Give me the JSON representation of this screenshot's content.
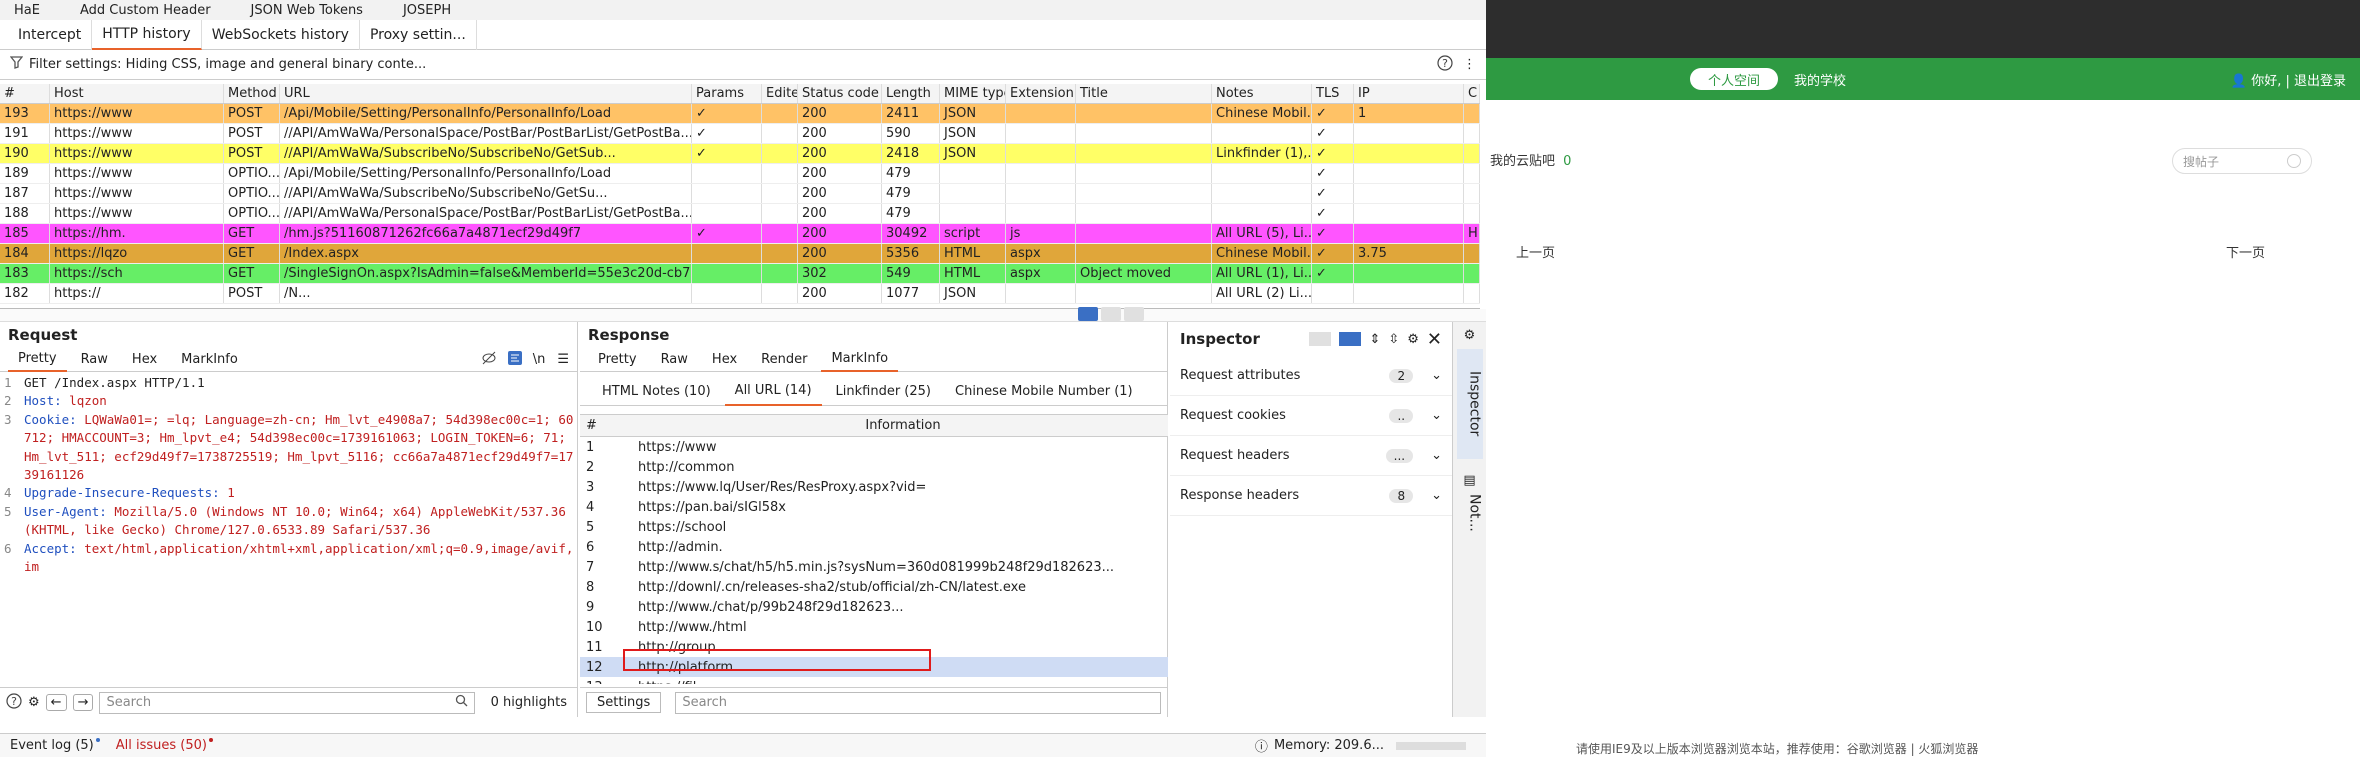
{
  "menubar": [
    "HaE",
    "Add Custom Header",
    "JSON Web Tokens",
    "JOSEPH"
  ],
  "tabs": [
    "Intercept",
    "HTTP history",
    "WebSockets history",
    "Proxy settin..."
  ],
  "filter": "Filter settings: Hiding CSS, image and general binary conte...",
  "columns": [
    "#",
    "Host",
    "Method",
    "URL",
    "Params",
    "Edited",
    "Status code",
    "Length",
    "MIME type",
    "Extension",
    "Title",
    "Notes",
    "TLS",
    "IP",
    "C"
  ],
  "rows": [
    {
      "id": "193",
      "host": "https://www",
      "method": "POST",
      "url": "/Api/Mobile/Setting/PersonalInfo/PersonalInfo/Load",
      "params": "✓",
      "status": "200",
      "length": "2411",
      "mime": "JSON",
      "ext": "",
      "title": "",
      "notes": "Chinese Mobil...",
      "tls": "✓",
      "ip": "1",
      "c": "",
      "bg": "#ffc266"
    },
    {
      "id": "191",
      "host": "https://www",
      "method": "POST",
      "url": "//API/AmWaWa/PersonalSpace/PostBar/PostBarList/GetPostBa...",
      "params": "✓",
      "status": "200",
      "length": "590",
      "mime": "JSON",
      "ext": "",
      "title": "",
      "notes": "",
      "tls": "✓",
      "ip": "",
      "c": "",
      "bg": "#ffffff"
    },
    {
      "id": "190",
      "host": "https://www",
      "method": "POST",
      "url": "//API/AmWaWa/SubscribeNo/SubscribeNo/GetSub...",
      "params": "✓",
      "status": "200",
      "length": "2418",
      "mime": "JSON",
      "ext": "",
      "title": "",
      "notes": "Linkfinder (1),...",
      "tls": "✓",
      "ip": "",
      "c": "",
      "bg": "#ffff66"
    },
    {
      "id": "189",
      "host": "https://www",
      "method": "OPTIO...",
      "url": "/Api/Mobile/Setting/PersonalInfo/PersonalInfo/Load",
      "params": "",
      "status": "200",
      "length": "479",
      "mime": "",
      "ext": "",
      "title": "",
      "notes": "",
      "tls": "✓",
      "ip": "",
      "c": "",
      "bg": "#ffffff"
    },
    {
      "id": "187",
      "host": "https://www",
      "method": "OPTIO...",
      "url": "//API/AmWaWa/SubscribeNo/SubscribeNo/GetSu...",
      "params": "",
      "status": "200",
      "length": "479",
      "mime": "",
      "ext": "",
      "title": "",
      "notes": "",
      "tls": "✓",
      "ip": "",
      "c": "",
      "bg": "#ffffff"
    },
    {
      "id": "188",
      "host": "https://www",
      "method": "OPTIO...",
      "url": "//API/AmWaWa/PersonalSpace/PostBar/PostBarList/GetPostBa...",
      "params": "",
      "status": "200",
      "length": "479",
      "mime": "",
      "ext": "",
      "title": "",
      "notes": "",
      "tls": "✓",
      "ip": "",
      "c": "",
      "bg": "#ffffff"
    },
    {
      "id": "185",
      "host": "https://hm.",
      "method": "GET",
      "url": "/hm.js?51160871262fc66a7a4871ecf29d49f7",
      "params": "✓",
      "status": "200",
      "length": "30492",
      "mime": "script",
      "ext": "js",
      "title": "",
      "notes": "All URL (5), Li...",
      "tls": "✓",
      "ip": "",
      "c": "H",
      "bg": "#ff55ff"
    },
    {
      "id": "184",
      "host": "https://lqzo",
      "method": "GET",
      "url": "/Index.aspx",
      "params": "",
      "status": "200",
      "length": "5356",
      "mime": "HTML",
      "ext": "aspx",
      "title": "",
      "notes": "Chinese Mobil...",
      "tls": "✓",
      "ip": "3.75",
      "c": "",
      "bg": "#e0a63a"
    },
    {
      "id": "183",
      "host": "https://sch",
      "method": "GET",
      "url": "/SingleSignOn.aspx?IsAdmin=false&MemberId=55e3c20d-cb7...",
      "params": "",
      "status": "302",
      "length": "549",
      "mime": "HTML",
      "ext": "aspx",
      "title": "Object moved",
      "notes": "All URL (1), Li...",
      "tls": "✓",
      "ip": "",
      "c": "",
      "bg": "#66ee66"
    },
    {
      "id": "182",
      "host": "https://",
      "method": "POST",
      "url": "/N...",
      "params": "",
      "status": "200",
      "length": "1077",
      "mime": "JSON",
      "ext": "",
      "title": "",
      "notes": "All URL (2) Li...",
      "tls": "",
      "ip": "",
      "c": "",
      "bg": "#ffffff"
    }
  ],
  "request": {
    "title": "Request",
    "tabs": [
      "Pretty",
      "Raw",
      "Hex",
      "MarkInfo"
    ],
    "newline": "\\n",
    "lines": [
      {
        "n": "1",
        "k": "",
        "t": "GET /Index.aspx HTTP/1.1"
      },
      {
        "n": "2",
        "k": "Host:",
        "t": " lqzon"
      },
      {
        "n": "3",
        "k": "Cookie:",
        "t": " LQWaWa01=; =lq; Language=zh-cn; Hm_lvt_e4908a7; 54d398ec00c=1; 60712; HMACCOUNT=3; Hm_lpvt_e4; 54d398ec00c=1739161063; LOGIN_TOKEN=6; 71; Hm_lvt_511; ecf29d49f7=1738725519; Hm_lpvt_5116; cc66a7a4871ecf29d49f7=1739161126"
      },
      {
        "n": "4",
        "k": "Upgrade-Insecure-Requests:",
        "t": " 1"
      },
      {
        "n": "5",
        "k": "User-Agent:",
        "t": " Mozilla/5.0 (Windows NT 10.0; Win64; x64) AppleWebKit/537.36 (KHTML, like Gecko) Chrome/127.0.6533.89 Safari/537.36"
      },
      {
        "n": "6",
        "k": "Accept:",
        "t": " text/html,application/xhtml+xml,application/xml;q=0.9,image/avif,im"
      }
    ],
    "search_placeholder": "Search",
    "highlights": "0 highlights"
  },
  "response": {
    "title": "Response",
    "tabs": [
      "Pretty",
      "Raw",
      "Hex",
      "Render",
      "MarkInfo"
    ],
    "subtabs": [
      "HTML Notes (10)",
      "All URL (14)",
      "Linkfinder (25)",
      "Chinese Mobile Number (1)"
    ],
    "columns": [
      "#",
      "Information"
    ],
    "urls": [
      {
        "n": "1",
        "u": "https://www"
      },
      {
        "n": "2",
        "u": "http://common"
      },
      {
        "n": "3",
        "u": "https://www.lq/User/Res/ResProxy.aspx?vid="
      },
      {
        "n": "4",
        "u": "https://pan.bai/sIGl58x"
      },
      {
        "n": "5",
        "u": "https://school"
      },
      {
        "n": "6",
        "u": "http://admin."
      },
      {
        "n": "7",
        "u": "http://www.s/chat/h5/h5.min.js?sysNum=360d081999b248f29d182623..."
      },
      {
        "n": "8",
        "u": "http://downl/.cn/releases-sha2/stub/official/zh-CN/latest.exe"
      },
      {
        "n": "9",
        "u": "http://www./chat/p/99b248f29d182623..."
      },
      {
        "n": "10",
        "u": "http://www./html"
      },
      {
        "n": "11",
        "u": "http://group"
      },
      {
        "n": "12",
        "u": "http://platform"
      },
      {
        "n": "13",
        "u": "https://fil"
      }
    ],
    "settings": "Settings",
    "search_placeholder": "Search"
  },
  "inspector": {
    "title": "Inspector",
    "items": [
      {
        "label": "Request attributes",
        "badge": "2"
      },
      {
        "label": "Request cookies",
        "badge": ".."
      },
      {
        "label": "Request headers",
        "badge": "..."
      },
      {
        "label": "Response headers",
        "badge": "8"
      }
    ]
  },
  "sidebar": {
    "inspector": "Inspector",
    "notes": "Not..."
  },
  "status": {
    "eventlog": "Event log (5)",
    "issues": "All issues (50)",
    "memory": "Memory: 209.6..."
  },
  "web": {
    "nav": [
      "个人空间",
      "我的学校"
    ],
    "greet": "你好,",
    "logout": "| 退出登录",
    "postbar": "我的云贴吧",
    "postbar_count": "0",
    "search_placeholder": "搜帖子",
    "prev": "上一页",
    "next": "下一页",
    "footer": "请使用IE9及以上版本浏览器浏览本站，推荐使用：谷歌浏览器 | 火狐浏览器"
  },
  "colors": {
    "accent": "#e8622a",
    "green": "#2e9a42",
    "selected": "#cfdcf4",
    "highlight_box": "#e01b1b"
  }
}
